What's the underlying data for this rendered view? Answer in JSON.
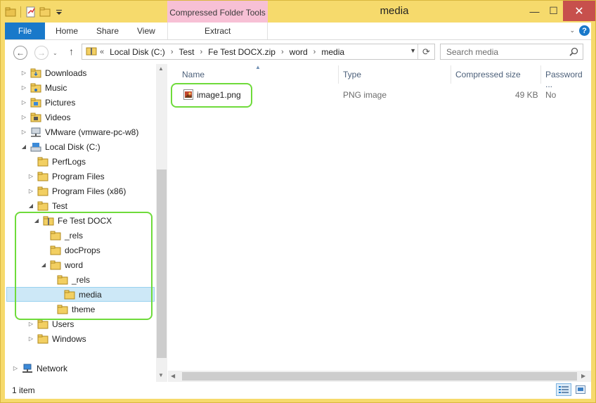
{
  "window": {
    "title": "media",
    "context_tab": "Compressed Folder Tools",
    "minimize": "—",
    "maximize": "☐",
    "close": "✕"
  },
  "ribbon": {
    "tabs": [
      "File",
      "Home",
      "Share",
      "View"
    ],
    "context_subtab": "Extract"
  },
  "address": {
    "breadcrumbs": [
      "Local Disk (C:)",
      "Test",
      "Fe Test DOCX.zip",
      "word",
      "media"
    ],
    "overflow": "«",
    "search_placeholder": "Search media"
  },
  "nav_tree": [
    {
      "label": "Downloads",
      "level": 1,
      "twist": "▷",
      "icon": "downloads-folder-icon"
    },
    {
      "label": "Music",
      "level": 1,
      "twist": "▷",
      "icon": "music-folder-icon"
    },
    {
      "label": "Pictures",
      "level": 1,
      "twist": "▷",
      "icon": "pictures-folder-icon"
    },
    {
      "label": "Videos",
      "level": 1,
      "twist": "▷",
      "icon": "videos-folder-icon"
    },
    {
      "label": "VMware (vmware-pc-w8)",
      "level": 1,
      "twist": "▷",
      "icon": "network-drive-icon"
    },
    {
      "label": "Local Disk (C:)",
      "level": 1,
      "twist": "◢",
      "icon": "local-disk-icon"
    },
    {
      "label": "PerfLogs",
      "level": 2,
      "twist": "",
      "icon": "folder-icon"
    },
    {
      "label": "Program Files",
      "level": 2,
      "twist": "▷",
      "icon": "folder-icon"
    },
    {
      "label": "Program Files (x86)",
      "level": 2,
      "twist": "▷",
      "icon": "folder-icon"
    },
    {
      "label": "Test",
      "level": 2,
      "twist": "◢",
      "icon": "folder-icon"
    },
    {
      "label": "Fe Test DOCX",
      "level": 3,
      "twist": "◢",
      "icon": "zip-folder-icon"
    },
    {
      "label": "_rels",
      "level": 4,
      "twist": "",
      "icon": "folder-icon"
    },
    {
      "label": "docProps",
      "level": 4,
      "twist": "",
      "icon": "folder-icon"
    },
    {
      "label": "word",
      "level": 4,
      "twist": "◢",
      "icon": "folder-icon"
    },
    {
      "label": "_rels",
      "level": 5,
      "twist": "",
      "icon": "folder-icon"
    },
    {
      "label": "media",
      "level": 5,
      "twist": "",
      "icon": "folder-icon",
      "selected": true
    },
    {
      "label": "theme",
      "level": 5,
      "twist": "",
      "icon": "folder-icon"
    },
    {
      "label": "Users",
      "level": 2,
      "twist": "▷",
      "icon": "folder-icon"
    },
    {
      "label": "Windows",
      "level": 2,
      "twist": "▷",
      "icon": "folder-icon"
    },
    {
      "label": "Network",
      "level": 0,
      "twist": "▷",
      "icon": "network-icon",
      "gap": true
    }
  ],
  "columns": [
    "Name",
    "Type",
    "Compressed size",
    "Password ..."
  ],
  "files": [
    {
      "name": "image1.png",
      "type": "PNG image",
      "compressed_size": "49 KB",
      "password": "No"
    }
  ],
  "status": {
    "item_count": "1 item"
  },
  "colors": {
    "title_bar": "#f6da6c",
    "context_tab": "#f7c0d5",
    "file_tab": "#1979ca",
    "selection": "#cde8f7",
    "highlight": "#6fdb3b"
  }
}
